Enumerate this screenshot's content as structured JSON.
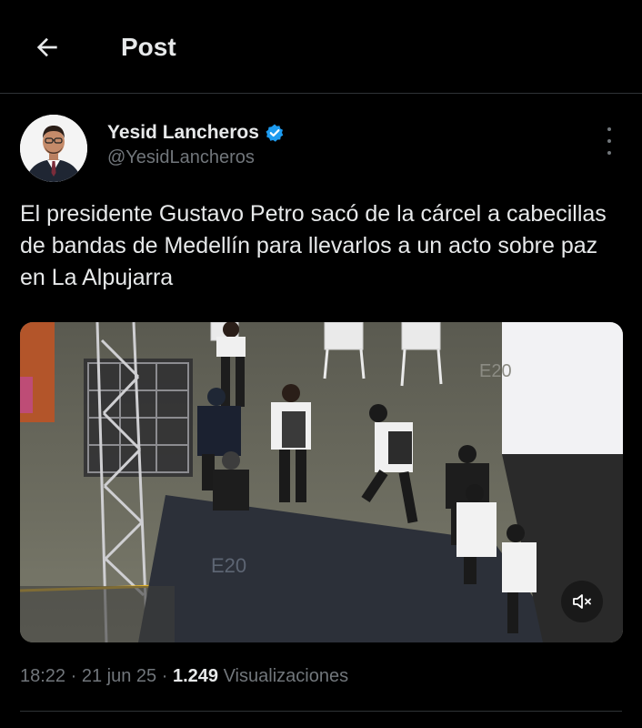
{
  "header": {
    "title": "Post",
    "back_icon": "arrow-left-icon"
  },
  "author": {
    "name": "Yesid Lancheros",
    "handle": "@YesidLancheros",
    "verified_icon": "verified-badge-icon",
    "verified_color": "#1d9bf0"
  },
  "tweet": {
    "text": "El presidente Gustavo Petro sacó de la cárcel a cabecillas de bandas de Medellín para llevarlos a un acto sobre paz en La Alpujarra"
  },
  "media": {
    "type": "video",
    "mute_icon": "speaker-muted-icon",
    "watermark_1": "E20",
    "watermark_2": "E20"
  },
  "meta": {
    "time": "18:22",
    "separator": "·",
    "date": "21 jun 25",
    "views_count": "1.249",
    "views_label": "Visualizaciones"
  },
  "colors": {
    "background": "#000000",
    "text_primary": "#e7e9ea",
    "text_secondary": "#71767b",
    "divider": "#2f3336"
  }
}
